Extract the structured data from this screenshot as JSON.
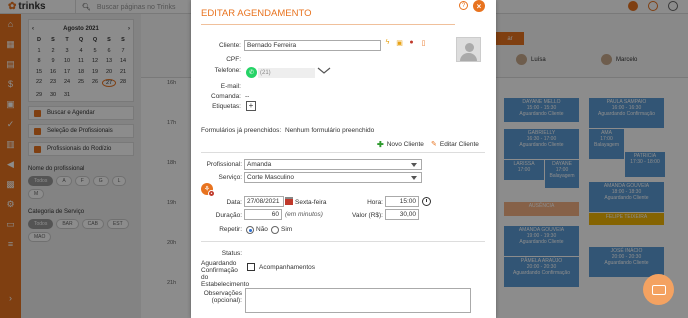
{
  "app": {
    "brand": "trinks",
    "search_placeholder": "Buscar páginas no Trinks"
  },
  "sidebar": {
    "calendar": {
      "month_label": "Agosto 2021",
      "weekdays": [
        "D",
        "S",
        "T",
        "Q",
        "Q",
        "S",
        "S"
      ],
      "days": [
        "1",
        "2",
        "3",
        "4",
        "5",
        "6",
        "7",
        "8",
        "9",
        "10",
        "11",
        "12",
        "13",
        "14",
        "15",
        "16",
        "17",
        "18",
        "19",
        "20",
        "21",
        "22",
        "23",
        "24",
        "25",
        "26",
        "27",
        "28",
        "29",
        "30",
        "31"
      ],
      "selected_day": "27"
    },
    "buttons": [
      "Buscar e Agendar",
      "Seleção de Profissionais",
      "Profissionais do Rodízio"
    ],
    "professional_name_label": "Nome do profissional",
    "professional_chips": [
      "Todos",
      "A",
      "F",
      "G",
      "L",
      "M"
    ],
    "service_category_label": "Categoria de Serviço",
    "service_chips": [
      "Todos",
      "BAR",
      "CAB",
      "EST",
      "MAO"
    ]
  },
  "schedule": {
    "columns": [
      "Luísa",
      "Marcelo"
    ],
    "times": [
      "16h",
      "",
      "17h",
      "",
      "18h",
      "",
      "19h",
      "",
      "20h",
      "",
      "21h",
      ""
    ],
    "appointments": [
      {
        "label": "DAYANE MELLO",
        "time": "15:00 - 15:30",
        "note": "Aguardando Cliente"
      },
      {
        "label": "PAULA SAMPAIO",
        "time": "16:00 - 16:30",
        "note": "Aguardando Confirmação"
      },
      {
        "label": "GABRIELLY",
        "time": "16:30 - 17:00",
        "note": "Aguardando Cliente"
      },
      {
        "label": "AMA",
        "time": "17:00",
        "note": "Balayagem"
      },
      {
        "label": "LARISSA",
        "time": "17:00",
        "note": ""
      },
      {
        "label": "DAYANE",
        "time": "17:00",
        "note": "Balayagem"
      },
      {
        "label": "PATRICIA",
        "time": "17:30 - 18:00",
        "note": ""
      },
      {
        "label": "AMANDA GOUVEIA",
        "time": "18:00 - 18:30",
        "note": "Aguardando Cliente"
      },
      {
        "label": "AUSÊNCIA",
        "time": "",
        "note": ""
      },
      {
        "label": "FELIPE TEIXEIRA",
        "time": "",
        "note": ""
      },
      {
        "label": "AMANDA GOUVEIA",
        "time": "19:00 - 19:30",
        "note": "Aguardando Cliente"
      },
      {
        "label": "JOSÉ INÁCIO",
        "time": "20:00 - 20:30",
        "note": "Aguardando Cliente"
      },
      {
        "label": "PÂMELA ARAÚJO",
        "time": "20:00 - 20:30",
        "note": "Aguardando Confirmação"
      }
    ],
    "top_button": "ar"
  },
  "modal": {
    "title": "EDITAR AGENDAMENTO",
    "help": "?",
    "close": "×",
    "cliente_label": "Cliente:",
    "cliente_value": "Bernado Ferreira",
    "cpf_label": "CPF:",
    "telefone_label": "Telefone:",
    "telefone_value": "(21)",
    "email_label": "E-mail:",
    "comanda_label": "Comanda:",
    "comanda_value": "--",
    "etiquetas_label": "Etiquetas:",
    "etiquetas_add": "+",
    "formularios_label": "Formulários já preenchidos:",
    "formularios_value": "Nenhum formulário preenchido",
    "novo_cliente": "Novo Cliente",
    "editar_cliente": "Editar Cliente",
    "profissional_label": "Profissional:",
    "profissional_value": "Amanda",
    "servico_label": "Serviço:",
    "servico_value": "Corte Masculino",
    "data_label": "Data:",
    "data_value": "27/08/2021",
    "weekday": "Sexta-feira",
    "hora_label": "Hora:",
    "hora_value": "15:00",
    "duracao_label": "Duração:",
    "duracao_value": "60",
    "duracao_unit": "(em minutos)",
    "valor_label": "Valor (R$):",
    "valor_value": "30,00",
    "repetir_label": "Repetir:",
    "repetir_nao": "Não",
    "repetir_sim": "Sim",
    "status_label": "Status:",
    "status_value": "Aguardando Confirmação do Estabelecimento",
    "acompanhamentos": "Acompanhamentos",
    "observacoes_label": "Observações (opcional):"
  },
  "colors": {
    "brand": "#e8731f",
    "blue_appt": "#5b9bd5",
    "chat": "#f4a261"
  }
}
